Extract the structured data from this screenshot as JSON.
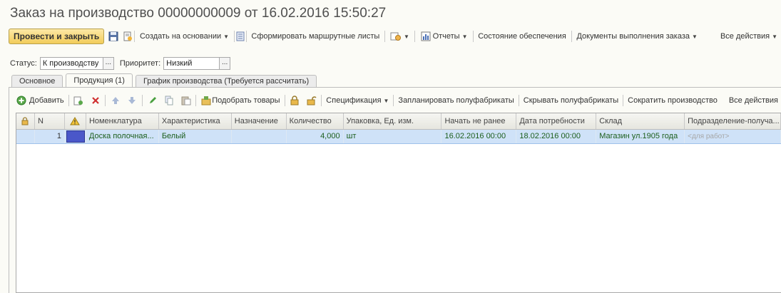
{
  "window": {
    "title": "Заказ на производство 00000000009 от 16.02.2016 15:50:27"
  },
  "toolbar": {
    "post_close": "Провести и закрыть",
    "create_based": "Создать на основании",
    "route_sheets": "Сформировать маршрутные листы",
    "reports": "Отчеты",
    "supply_state": "Состояние обеспечения",
    "exec_docs": "Документы выполнения заказа",
    "all_actions": "Все действия"
  },
  "fields": {
    "status_label": "Статус:",
    "status_value": "К производству",
    "priority_label": "Приоритет:",
    "priority_value": "Низкий",
    "pick_glyph": "..."
  },
  "tabs": [
    {
      "label": "Основное"
    },
    {
      "label": "Продукция (1)"
    },
    {
      "label": "График производства (Требуется рассчитать)"
    }
  ],
  "grid_toolbar": {
    "add": "Добавить",
    "pick_goods": "Подобрать товары",
    "spec": "Спецификация",
    "plan_semi": "Запланировать полуфабрикаты",
    "hide_semi": "Скрывать полуфабрикаты",
    "reduce": "Сократить производство",
    "all_actions": "Все действия"
  },
  "table": {
    "columns": [
      "N",
      "Номенклатура",
      "Характеристика",
      "Назначение",
      "Количество",
      "Упаковка, Ед. изм.",
      "Начать не ранее",
      "Дата потребности",
      "Склад",
      "Подразделение-получа..."
    ],
    "rows": [
      {
        "n": "1",
        "item": "Доска полочная...",
        "characteristic": "Белый",
        "purpose": "",
        "qty": "4,000",
        "unit": "шт",
        "start": "16.02.2016 00:00",
        "need_date": "18.02.2016 00:00",
        "warehouse": "Магазин ул.1905 года",
        "division": "<для работ>"
      }
    ]
  },
  "colors": {
    "accent_button": "#f2cc5a",
    "row_selected": "#cfe2f8",
    "cell_selected": "#4a57c9",
    "text_green": "#1c5e1c"
  }
}
